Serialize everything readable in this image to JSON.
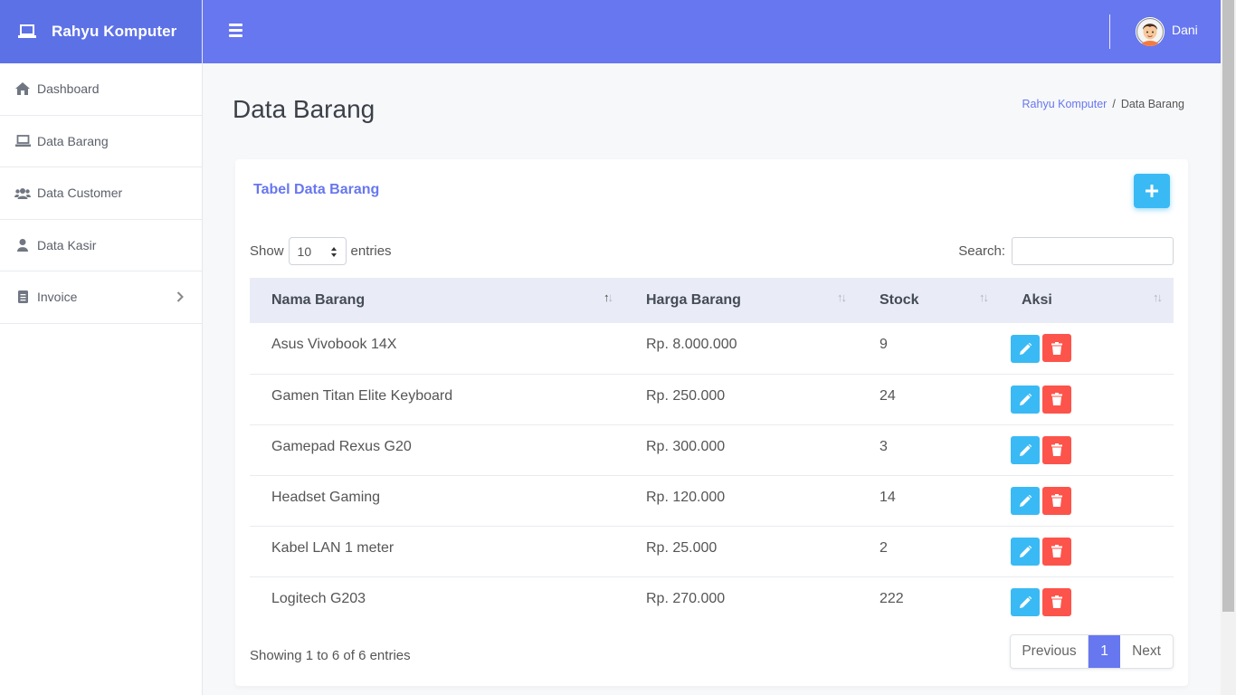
{
  "brand": {
    "name": "Rahyu Komputer",
    "icon": "laptop-icon"
  },
  "sidebar": {
    "items": [
      {
        "label": "Dashboard",
        "icon": "home-icon"
      },
      {
        "label": "Data Barang",
        "icon": "laptop-icon"
      },
      {
        "label": "Data Customer",
        "icon": "users-icon"
      },
      {
        "label": "Data Kasir",
        "icon": "user-icon"
      },
      {
        "label": "Invoice",
        "icon": "file-icon",
        "has_submenu": true
      }
    ]
  },
  "topbar": {
    "user_name": "Dani",
    "menu_icon": "hamburger-icon"
  },
  "page": {
    "title": "Data Barang",
    "breadcrumb": {
      "home": "Rahyu Komputer",
      "separator": "/",
      "current": "Data Barang"
    }
  },
  "card": {
    "title": "Tabel Data Barang",
    "add_icon": "plus-icon",
    "show_label": "Show",
    "entries_value": "10",
    "entries_label": "entries",
    "search_label": "Search:",
    "search_value": ""
  },
  "table": {
    "columns": [
      "Nama Barang",
      "Harga Barang",
      "Stock",
      "Aksi"
    ],
    "rows": [
      {
        "nama": "Asus Vivobook 14X",
        "harga": "Rp. 8.000.000",
        "stock": "9"
      },
      {
        "nama": "Gamen Titan Elite Keyboard",
        "harga": "Rp. 250.000",
        "stock": "24"
      },
      {
        "nama": "Gamepad Rexus G20",
        "harga": "Rp. 300.000",
        "stock": "3"
      },
      {
        "nama": "Headset Gaming",
        "harga": "Rp. 120.000",
        "stock": "14"
      },
      {
        "nama": "Kabel LAN 1 meter",
        "harga": "Rp. 25.000",
        "stock": "2"
      },
      {
        "nama": "Logitech G203",
        "harga": "Rp. 270.000",
        "stock": "222"
      }
    ]
  },
  "footer": {
    "info": "Showing 1 to 6 of 6 entries",
    "prev": "Previous",
    "page": "1",
    "next": "Next"
  },
  "colors": {
    "primary": "#6777ef",
    "info": "#3abaf4",
    "danger": "#fc544b"
  }
}
